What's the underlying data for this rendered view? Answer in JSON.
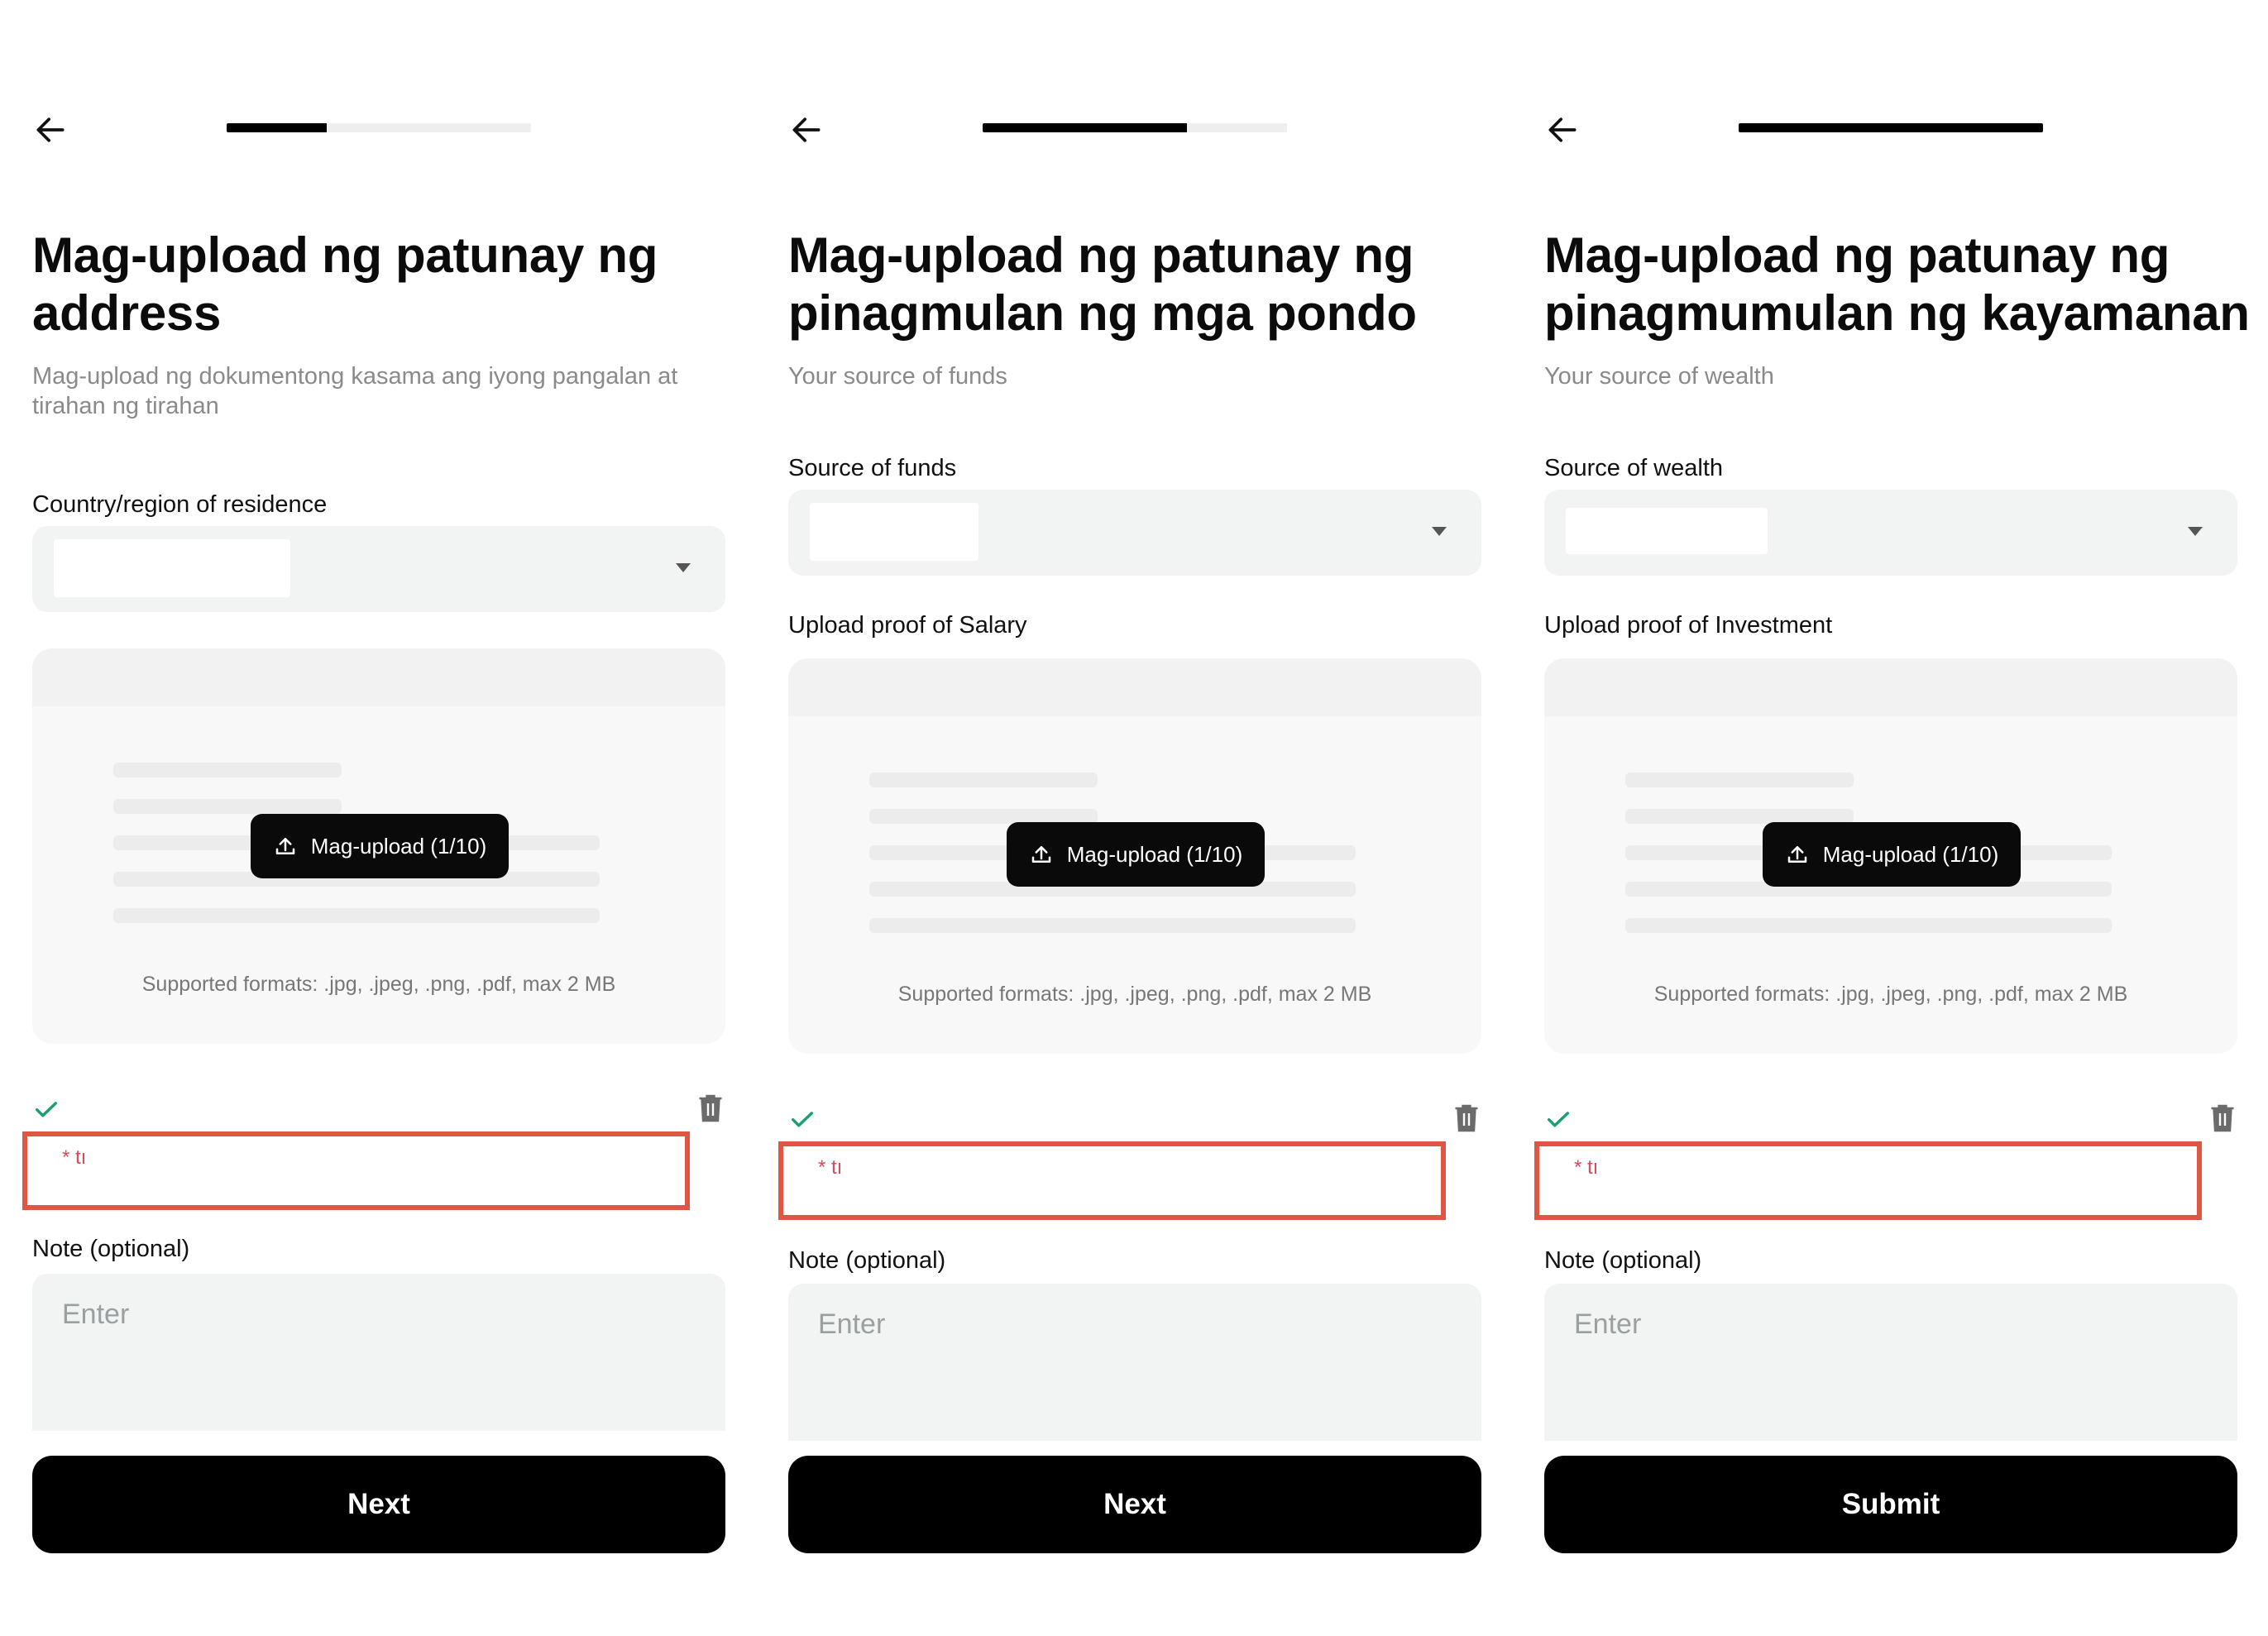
{
  "screens": [
    {
      "progress": 0.33,
      "title": "Mag-upload ng patunay ng address",
      "subtitle": "Mag-upload ng dokumentong kasama ang iyong pangalan at tirahan ng tirahan",
      "select_label": "Country/region of residence",
      "select_value": "",
      "upload_label": "",
      "upload_button": "Mag-upload (1/10)",
      "formats": "Supported formats: .jpg, .jpeg, .png, .pdf, max 2 MB",
      "file_name": "* tı",
      "note_label": "Note (optional)",
      "note_placeholder": "Enter",
      "button": "Next"
    },
    {
      "progress": 0.67,
      "title": "Mag-upload ng patunay ng pinagmulan ng mga pondo",
      "subtitle": "Your source of funds",
      "select_label": "Source of funds",
      "select_value": "",
      "upload_label": "Upload proof of Salary",
      "upload_button": "Mag-upload (1/10)",
      "formats": "Supported formats: .jpg, .jpeg, .png, .pdf, max 2 MB",
      "file_name": "* tı",
      "note_label": "Note (optional)",
      "note_placeholder": "Enter",
      "button": "Next"
    },
    {
      "progress": 1.0,
      "title": "Mag-upload ng patunay ng pinagmumulan ng kayamanan",
      "subtitle": "Your source of wealth",
      "select_label": "Source of wealth",
      "select_value": "",
      "upload_label": "Upload proof of Investment",
      "upload_button": "Mag-upload (1/10)",
      "formats": "Supported formats: .jpg, .jpeg, .png, .pdf, max 2 MB",
      "file_name": "* tı",
      "note_label": "Note (optional)",
      "note_placeholder": "Enter",
      "button": "Submit"
    }
  ],
  "icons": {
    "back": "arrow-left-icon",
    "upload": "upload-icon",
    "check": "check-icon",
    "trash": "trash-icon",
    "caret": "caret-down-icon"
  },
  "colors": {
    "primary": "#000000",
    "field_bg": "#f2f4f4",
    "check": "#1aa06d",
    "highlight": "#e15544",
    "file_name": "#d74b5b",
    "muted": "#8a8a8a"
  }
}
